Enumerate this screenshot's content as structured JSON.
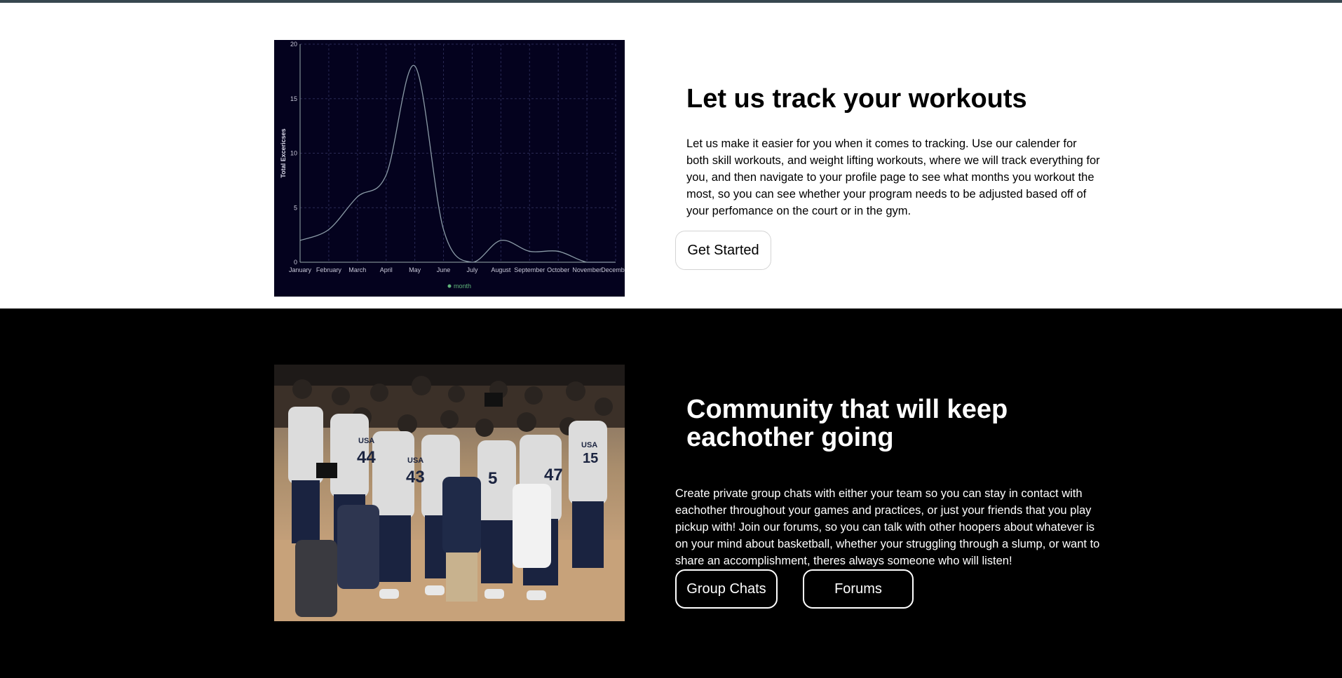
{
  "workouts": {
    "title": "Let us track your workouts",
    "description": "Let us make it easier for you when it comes to tracking. Use our calender for both skill workouts, and weight lifting workouts, where we will track everything for you, and then navigate to your profile page to see what months you workout the most, so you can see whether your program needs to be adjusted based off of your perfomance on the court or in the gym.",
    "cta_label": "Get Started"
  },
  "community": {
    "title": "Community that will keep eachother going",
    "description": "Create private group chats with either your team so you can stay in contact with eachother throughout your games and practices, or just your friends that you play pickup with! Join our forums, so you can talk with other hoopers about whatever is on your mind about basketball, whether your struggling through a slump, or want to share an accomplishment, theres always someone who will listen!",
    "group_chats_label": "Group Chats",
    "forums_label": "Forums",
    "photo_jersey_numbers": [
      "44",
      "43",
      "5",
      "47",
      "15"
    ],
    "photo_jersey_text": "USA"
  },
  "colors": {
    "top_bar": "#37474f",
    "chart_background": "#04021e",
    "chart_line": "#8a9aa6",
    "legend_marker": "#5fb47a"
  },
  "chart_data": {
    "type": "line",
    "categories": [
      "January",
      "February",
      "March",
      "April",
      "May",
      "June",
      "July",
      "August",
      "September",
      "October",
      "November",
      "December"
    ],
    "series": [
      {
        "name": "month",
        "values": [
          2,
          3,
          6,
          8,
          18,
          3,
          0,
          2,
          1,
          1,
          0,
          0
        ]
      }
    ],
    "ylabel": "Total Excericses",
    "ylim": [
      0,
      20
    ],
    "yticks": [
      "0",
      "5",
      "10",
      "15",
      "20"
    ],
    "grid": true,
    "legend": "bottom"
  }
}
